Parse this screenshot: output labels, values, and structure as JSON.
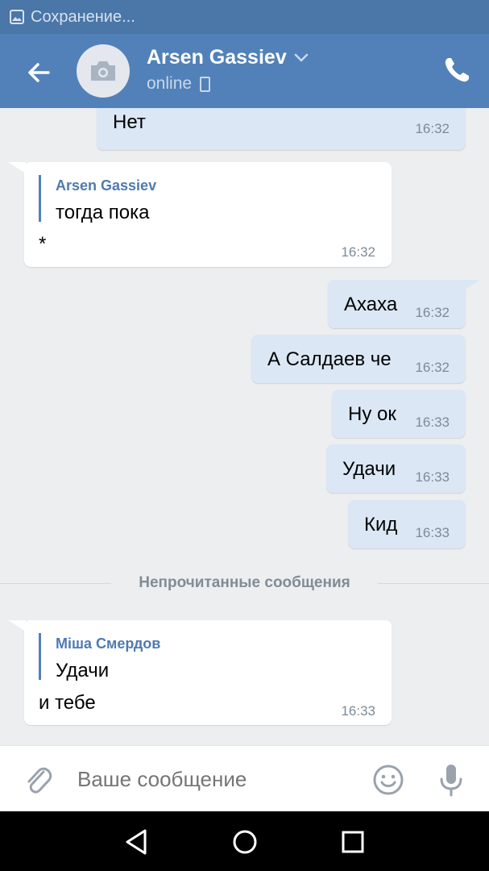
{
  "status_bar": {
    "text": "Сохранение..."
  },
  "header": {
    "name": "Arsen Gassiev",
    "status": "online"
  },
  "messages": {
    "m1": {
      "text": "Нет",
      "time": "16:32"
    },
    "m2": {
      "author": "Arsen Gassiev",
      "quote": "тогда пока",
      "text": "*",
      "time": "16:32"
    },
    "m3": {
      "text": "Ахаха",
      "time": "16:32"
    },
    "m4": {
      "text": "А Салдаев че",
      "time": "16:32"
    },
    "m5": {
      "text": "Ну ок",
      "time": "16:33"
    },
    "m6": {
      "text": "Удачи",
      "time": "16:33"
    },
    "m7": {
      "text": "Кид",
      "time": "16:33"
    },
    "m8": {
      "author": "Міша Смердов",
      "quote": "Удачи",
      "text": "и тебе",
      "time": "16:33"
    }
  },
  "divider": {
    "label": "Непрочитанные сообщения"
  },
  "composer": {
    "placeholder": "Ваше сообщение"
  },
  "colors": {
    "header": "#5181b8",
    "status_bar": "#4a76a8",
    "outgoing_bubble": "#dbe7f5",
    "incoming_bubble": "#ffffff"
  },
  "icons": [
    "back-arrow-icon",
    "camera-icon",
    "chevron-down-icon",
    "phone-icon",
    "paperclip-icon",
    "smile-icon",
    "microphone-icon",
    "nav-back-icon",
    "nav-home-icon",
    "nav-recents-icon"
  ]
}
